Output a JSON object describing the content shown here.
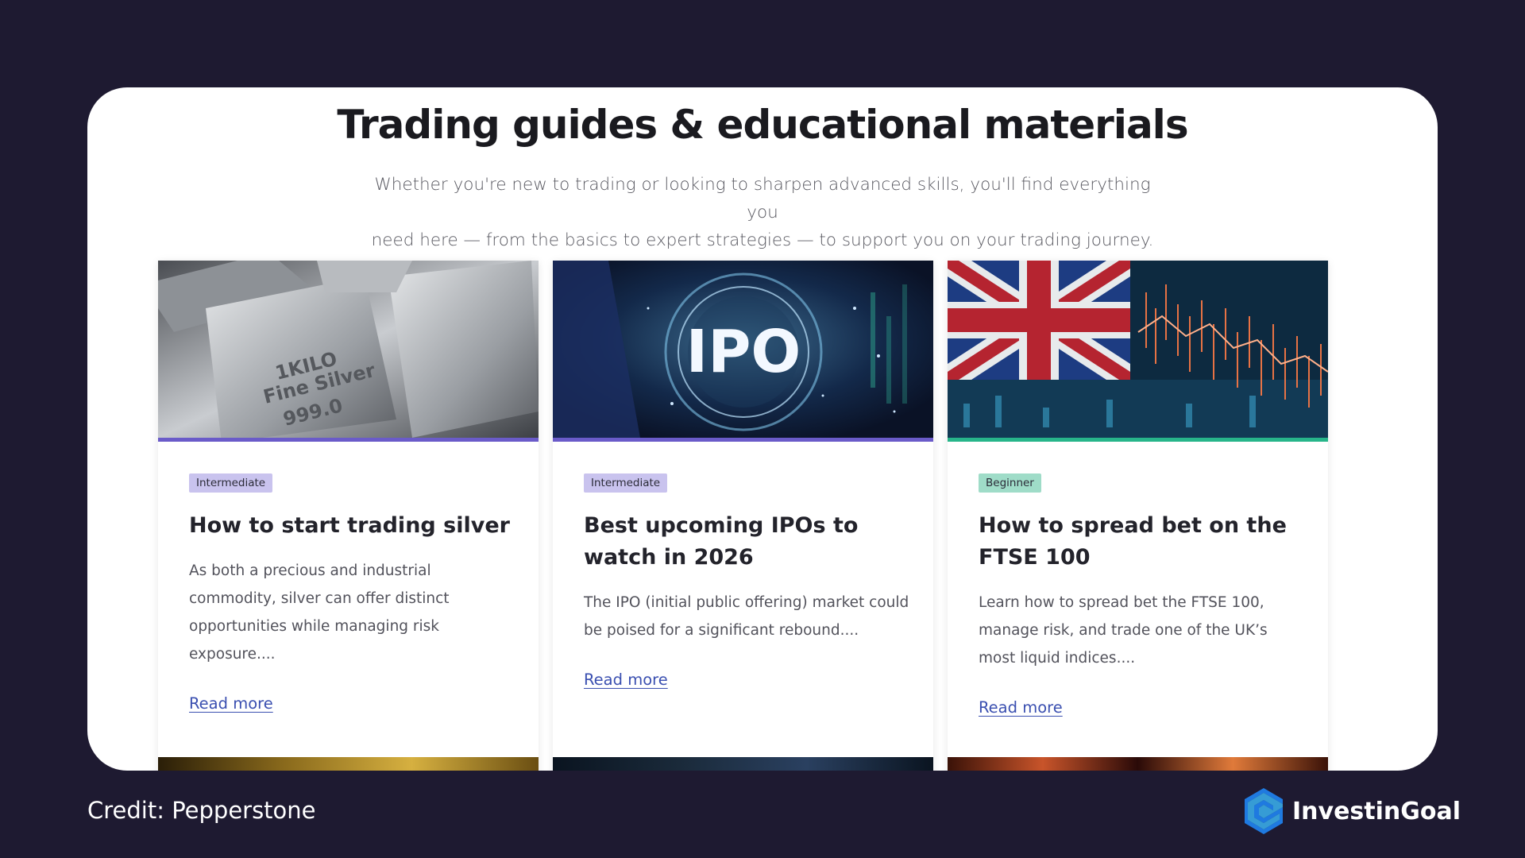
{
  "header": {
    "title": "Trading guides & educational materials",
    "intro_line1": "Whether you're new to trading or looking to sharpen advanced skills, you'll find everything you",
    "intro_line2": "need here — from the basics to expert strategies — to support you on your trading journey."
  },
  "cards": [
    {
      "level": "Intermediate",
      "level_color": "#c9c3ee",
      "accent_color": "#6a5bc9",
      "title": "How to start trading silver",
      "description": "As both a precious and industrial commodity, silver can offer distinct opportunities while managing risk exposure....",
      "link": "Read more",
      "image_icon": "silver-bars-image",
      "image_text_1": "1KILO",
      "image_text_2": "Fine Silver",
      "image_text_3": "999.0"
    },
    {
      "level": "Intermediate",
      "level_color": "#c9c3ee",
      "accent_color": "#6a5bc9",
      "title": "Best upcoming IPOs to watch in 2026",
      "description": "The IPO (initial public offering) market could be poised for a significant rebound....",
      "link": "Read more",
      "image_icon": "ipo-image",
      "image_text": "IPO"
    },
    {
      "level": "Beginner",
      "level_color": "#9fdcc8",
      "accent_color": "#27b58a",
      "title": "How to spread bet on the FTSE 100",
      "description": "Learn how to spread bet the FTSE 100, manage risk, and trade one of the UK’s most liquid indices....",
      "link": "Read more",
      "image_icon": "uk-flag-chart-image"
    }
  ],
  "footer": {
    "credit": "Credit: Pepperstone",
    "brand": "InvestinGoal"
  },
  "colors": {
    "background": "#1e1a31",
    "panel": "#ffffff",
    "link": "#3a4fb0"
  }
}
